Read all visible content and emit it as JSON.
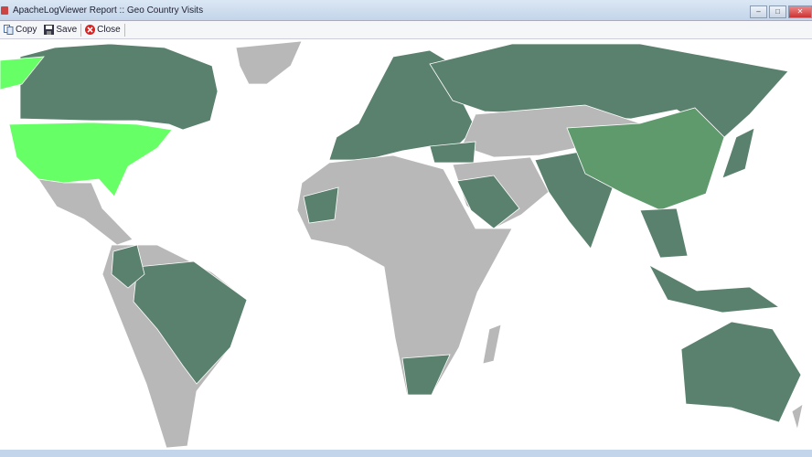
{
  "window": {
    "title": "ApacheLogViewer Report :: Geo Country Visits",
    "minimize": "–",
    "maximize": "□",
    "close": "✕"
  },
  "toolbar": {
    "copy": "Copy",
    "save": "Save",
    "close": "Close"
  },
  "colors": {
    "land": "#b8b8b8",
    "visited": "#5a806e",
    "medium": "#5e9a6c",
    "top": "#66ff66",
    "ocean": "#ffffff"
  },
  "map": {
    "top_country": "United States",
    "medium_country": "China",
    "visited_countries": [
      "Canada",
      "Brazil",
      "Colombia",
      "Russia",
      "Europe",
      "India",
      "Saudi Arabia",
      "Mauritania",
      "South Africa",
      "Australia",
      "Japan",
      "Indonesia",
      "Turkey",
      "Vietnam",
      "Pakistan"
    ]
  }
}
